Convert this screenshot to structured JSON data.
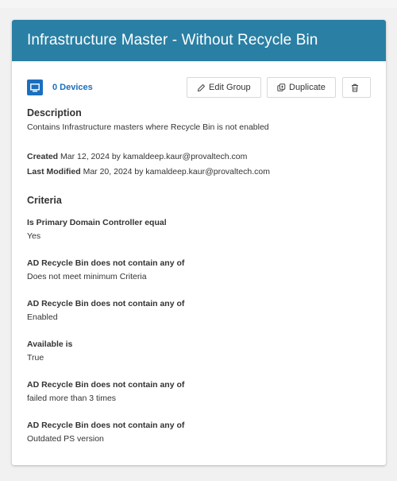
{
  "header": {
    "title": "Infrastructure Master - Without Recycle Bin"
  },
  "toolbar": {
    "devices_label": "0 Devices",
    "edit_label": "Edit Group",
    "duplicate_label": "Duplicate"
  },
  "description": {
    "heading": "Description",
    "text": "Contains Infrastructure masters where Recycle Bin is not enabled"
  },
  "meta": {
    "created_label": "Created",
    "created_value": "Mar 12, 2024 by kamaldeep.kaur@provaltech.com",
    "modified_label": "Last Modified",
    "modified_value": "Mar 20, 2024 by kamaldeep.kaur@provaltech.com"
  },
  "criteria": {
    "heading": "Criteria",
    "items": [
      {
        "label": "Is Primary Domain Controller equal",
        "value": "Yes"
      },
      {
        "label": "AD Recycle Bin does not contain any of",
        "value": "Does not meet minimum Criteria"
      },
      {
        "label": "AD Recycle Bin does not contain any of",
        "value": "Enabled"
      },
      {
        "label": "Available is",
        "value": "True"
      },
      {
        "label": "AD Recycle Bin does not contain any of",
        "value": "failed more than 3 times"
      },
      {
        "label": "AD Recycle Bin does not contain any of",
        "value": "Outdated PS version"
      }
    ]
  },
  "colors": {
    "header_bg": "#2a7fa4",
    "accent": "#1a6fbf"
  },
  "icons": [
    "monitor-icon",
    "pencil-icon",
    "duplicate-icon",
    "trash-icon"
  ]
}
